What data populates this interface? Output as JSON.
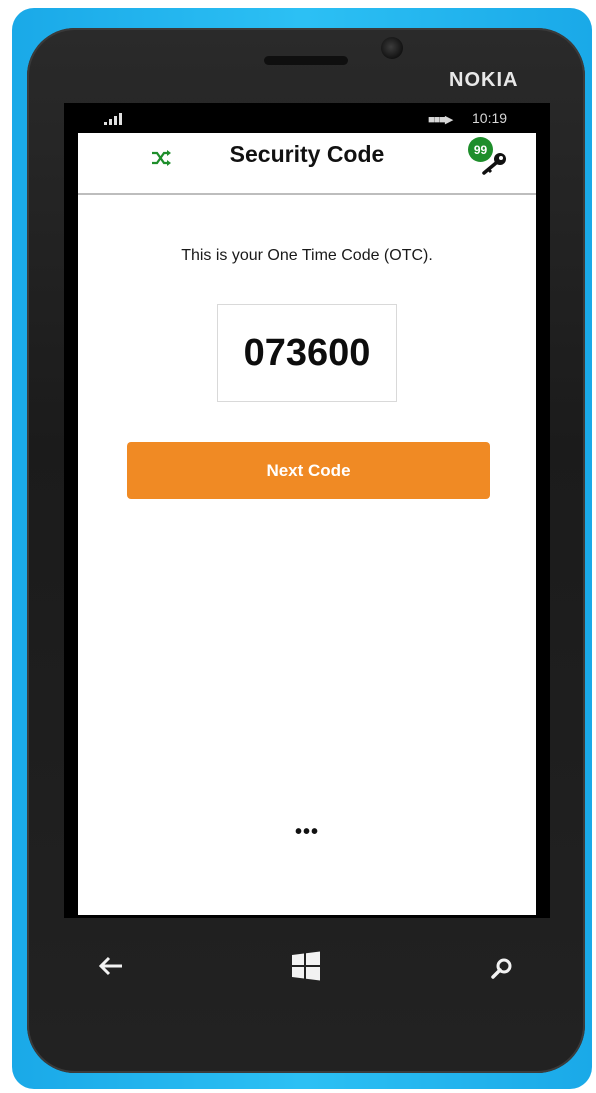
{
  "device": {
    "brand": "NOKIA",
    "status_time": "10:19",
    "battery_text": "■■■▶"
  },
  "header": {
    "title": "Security Code",
    "badge_count": "99",
    "left_icon": "shuffle-icon",
    "right_icon": "key-icon"
  },
  "main": {
    "message": "This is your One Time Code (OTC).",
    "code": "073600",
    "next_button_label": "Next Code",
    "more_label": "•••"
  },
  "nav": {
    "back_icon": "back-arrow-icon",
    "home_icon": "windows-icon",
    "search_icon": "search-icon"
  },
  "colors": {
    "shell": "#1aa9e8",
    "accent": "#f08a24",
    "badge": "#1e8e2b",
    "shuffle_icon": "#1e8e2b"
  }
}
